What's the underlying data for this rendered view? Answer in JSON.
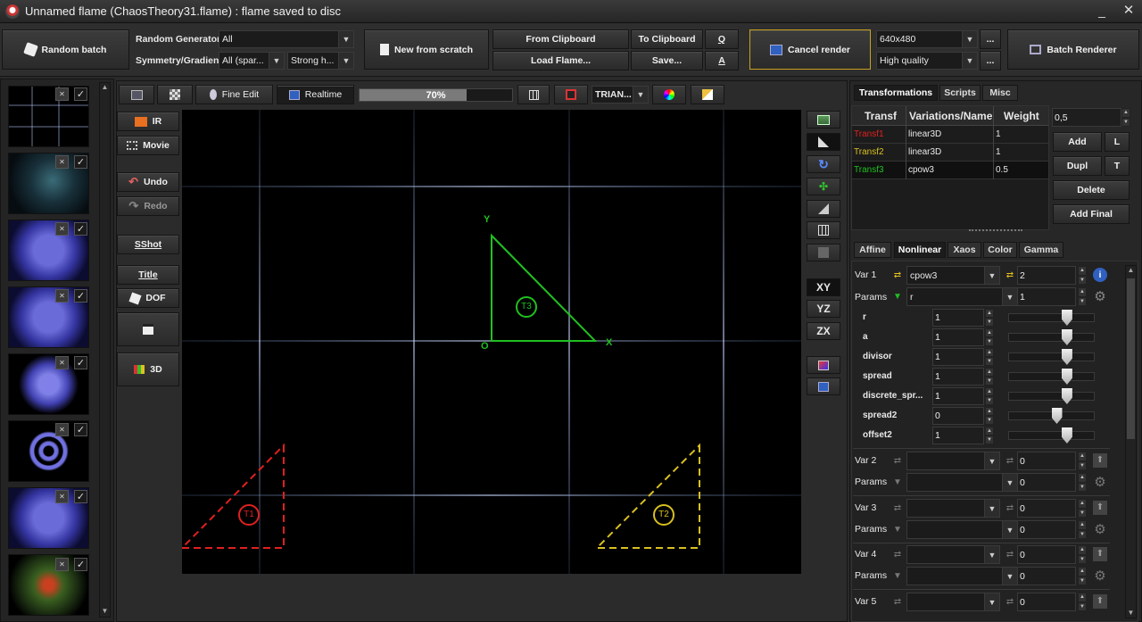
{
  "window": {
    "title": "Unnamed flame (ChaosTheory31.flame) : flame saved to disc"
  },
  "toolbar": {
    "random_batch": "Random batch",
    "random_generator_label": "Random Generator",
    "random_generator_value": "All",
    "symmetry_label": "Symmetry/Gradient",
    "symmetry_value": "All (spar...",
    "strong_value": "Strong h...",
    "new_from_scratch": "New from scratch",
    "from_clipboard": "From Clipboard",
    "to_clipboard": "To Clipboard",
    "q": "Q",
    "load_flame": "Load Flame...",
    "save": "Save...",
    "a": "A",
    "cancel_render": "Cancel render",
    "resolution": "640x480",
    "quality": "High quality",
    "dots": "...",
    "batch_renderer": "Batch Renderer"
  },
  "preview_toolbar": {
    "fine_edit": "Fine Edit",
    "realtime": "Realtime",
    "progress_text": "70%",
    "progress": 0.7,
    "triangle_mode": "TRIAN..."
  },
  "left_tools": {
    "ir": "IR",
    "movie": "Movie",
    "undo": "Undo",
    "redo": "Redo",
    "sshot": "SShot",
    "title": "Title",
    "dof": "DOF",
    "3d": "3D"
  },
  "view_buttons": {
    "xy": "XY",
    "yz": "YZ",
    "zx": "ZX"
  },
  "canvas": {
    "axis_y": "Y",
    "axis_x": "X",
    "origin": "O",
    "t1": "T1",
    "t2": "T2",
    "t3": "T3"
  },
  "right_tabs": {
    "transformations": "Transformations",
    "scripts": "Scripts",
    "misc": "Misc"
  },
  "transform_table": {
    "headers": [
      "Transf",
      "Variations/Name",
      "Weight"
    ],
    "rows": [
      {
        "name": "Transf1",
        "variation": "linear3D",
        "weight": "1"
      },
      {
        "name": "Transf2",
        "variation": "linear3D",
        "weight": "1"
      },
      {
        "name": "Transf3",
        "variation": "cpow3",
        "weight": "0.5"
      }
    ],
    "colors": [
      "#e02020",
      "#d8c020",
      "#20c020"
    ]
  },
  "transform_actions": {
    "value": "0,5",
    "add": "Add",
    "l": "L",
    "dupl": "Dupl",
    "t": "T",
    "delete": "Delete",
    "add_final": "Add Final"
  },
  "subtabs": {
    "affine": "Affine",
    "nonlinear": "Nonlinear",
    "xaos": "Xaos",
    "color": "Color",
    "gamma": "Gamma"
  },
  "var1": {
    "label": "Var 1",
    "name": "cpow3",
    "amount": "2",
    "params_label": "Params",
    "param_sel": "r",
    "param_val": "1",
    "params": [
      {
        "name": "r",
        "value": "1",
        "level": 0.62
      },
      {
        "name": "a",
        "value": "1",
        "level": 0.62
      },
      {
        "name": "divisor",
        "value": "1",
        "level": 0.62
      },
      {
        "name": "spread",
        "value": "1",
        "level": 0.62
      },
      {
        "name": "discrete_spr...",
        "value": "1",
        "level": 0.62
      },
      {
        "name": "spread2",
        "value": "0",
        "level": 0.5
      },
      {
        "name": "offset2",
        "value": "1",
        "level": 0.62
      }
    ]
  },
  "other_vars": [
    {
      "label": "Var 2",
      "amount": "0",
      "params_label": "Params",
      "param_val": "0"
    },
    {
      "label": "Var 3",
      "amount": "0",
      "params_label": "Params",
      "param_val": "0"
    },
    {
      "label": "Var 4",
      "amount": "0",
      "params_label": "Params",
      "param_val": "0"
    },
    {
      "label": "Var 5",
      "amount": "0"
    }
  ]
}
